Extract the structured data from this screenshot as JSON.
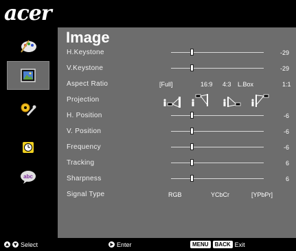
{
  "brand": {
    "logo_text": "acer"
  },
  "sidebar": {
    "items": [
      {
        "name": "color",
        "icon": "palette-icon"
      },
      {
        "name": "image",
        "icon": "picture-icon",
        "active": true
      },
      {
        "name": "management",
        "icon": "tools-icon"
      },
      {
        "name": "timer",
        "icon": "clock-icon"
      },
      {
        "name": "language",
        "icon": "speech-bubble-icon",
        "text": "abc"
      }
    ]
  },
  "panel": {
    "title": "Image",
    "rows": {
      "h_keystone": {
        "label": "H.Keystone",
        "value": "-29",
        "level": 0.22
      },
      "v_keystone": {
        "label": "V.Keystone",
        "value": "-29",
        "level": 0.22
      },
      "aspect_ratio": {
        "label": "Aspect Ratio",
        "options": [
          "[Full]",
          "16:9",
          "4:3",
          "L.Box",
          "1:1"
        ],
        "selected": "[Full]"
      },
      "projection": {
        "label": "Projection",
        "options": [
          "front-desktop",
          "front-ceiling",
          "rear-desktop",
          "rear-ceiling"
        ],
        "selected": "front-desktop"
      },
      "h_position": {
        "label": "H. Position",
        "value": "-6",
        "level": 0.22
      },
      "v_position": {
        "label": "V. Position",
        "value": "-6",
        "level": 0.22
      },
      "frequency": {
        "label": "Frequency",
        "value": "-6",
        "level": 0.22
      },
      "tracking": {
        "label": "Tracking",
        "value": "6",
        "level": 0.22
      },
      "sharpness": {
        "label": "Sharpness",
        "value": "6",
        "level": 0.22
      },
      "signal_type": {
        "label": "Signal Type",
        "options": [
          "RGB",
          "YCbCr",
          "[YPbPr]"
        ],
        "selected": "[YPbPr]"
      }
    }
  },
  "footer": {
    "select_label": "Select",
    "enter_label": "Enter",
    "menu_key": "MENU",
    "back_key": "BACK",
    "exit_label": "Exit"
  },
  "colors": {
    "panel_bg": "#6d6d6d",
    "sidebar_active": "#6a6a6a",
    "background": "#000000"
  }
}
